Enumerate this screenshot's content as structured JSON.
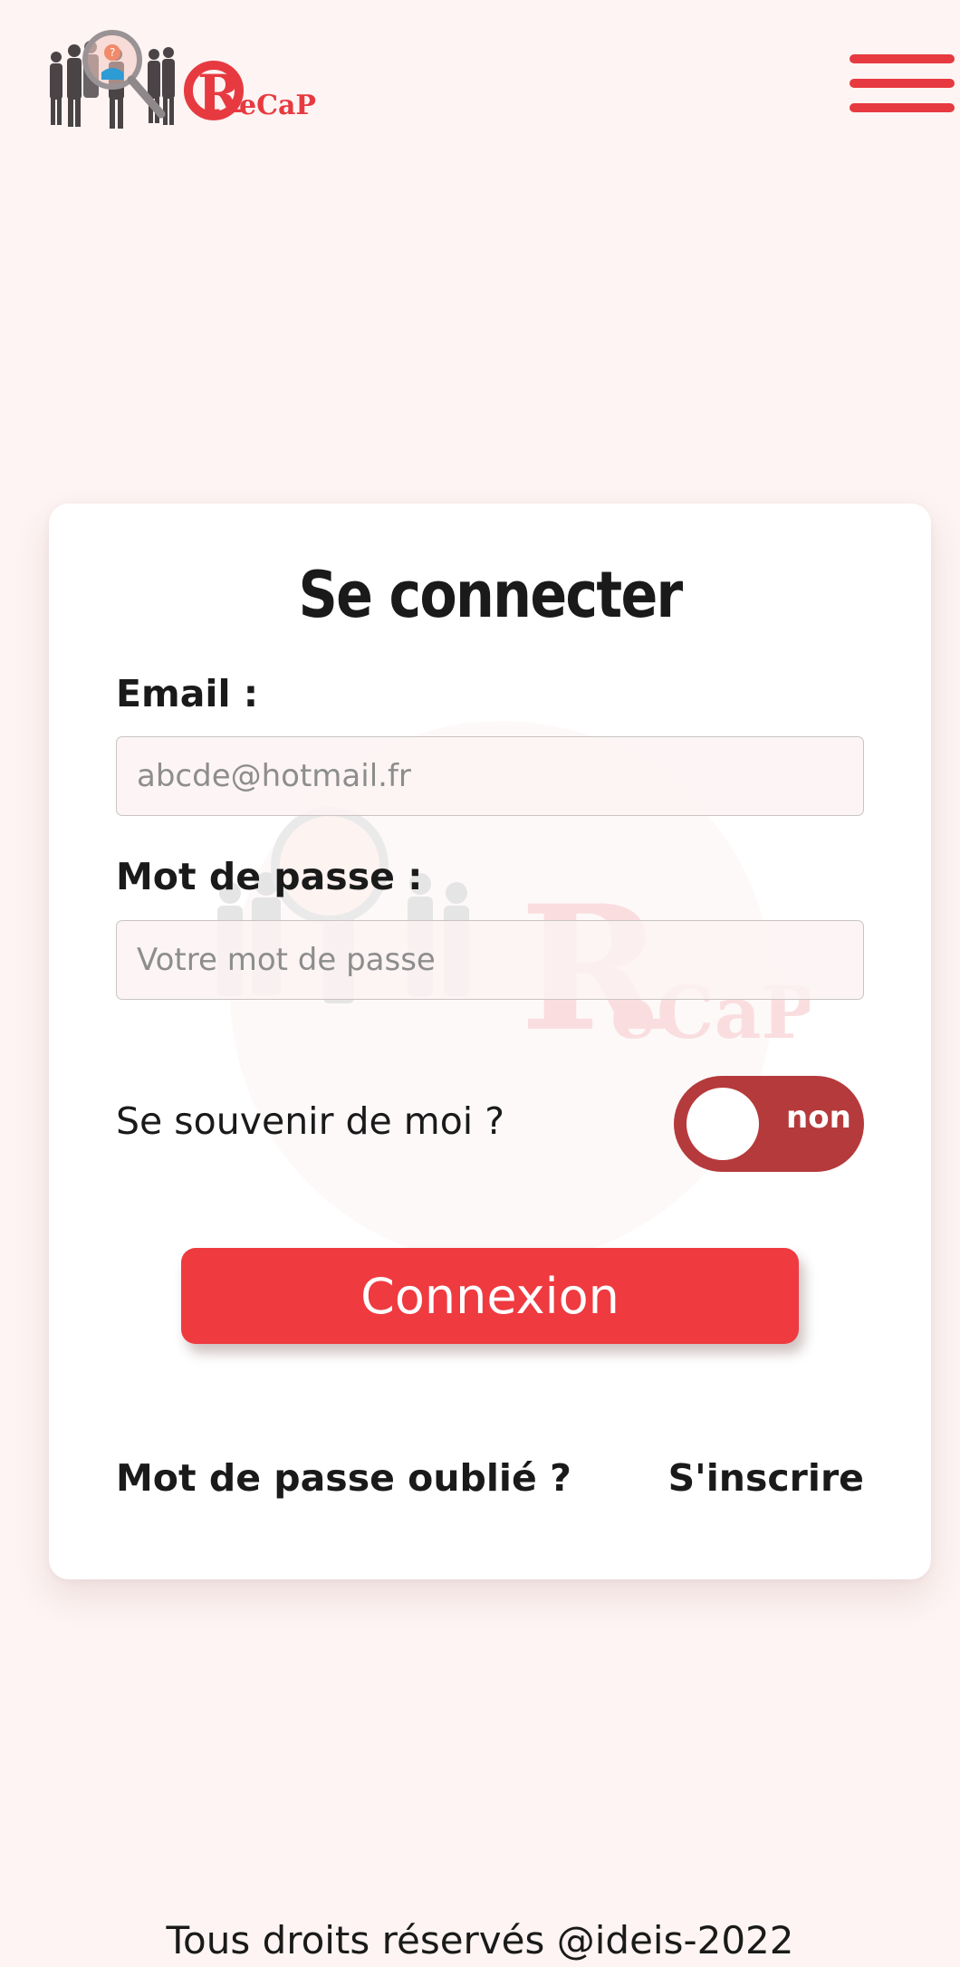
{
  "brand": {
    "name": "ReCaP",
    "color": "#e63a40"
  },
  "header": {
    "menu_icon": "hamburger-icon"
  },
  "login": {
    "title": "Se connecter",
    "email_label": "Email :",
    "email_placeholder": "abcde@hotmail.fr",
    "email_value": "",
    "password_label": "Mot de passe :",
    "password_placeholder": "Votre mot de passe",
    "password_value": "",
    "remember_label": "Se souvenir de moi ?",
    "remember_state": "non",
    "remember_on": false,
    "submit_label": "Connexion",
    "forgot_label": "Mot de passe oublié ?",
    "register_label": "S'inscrire"
  },
  "colors": {
    "background": "#fdf4f3",
    "accent": "#ef3a40",
    "toggle_off": "#b53a3c"
  },
  "footer": {
    "text": "Tous droits réservés @ideis-2022"
  }
}
